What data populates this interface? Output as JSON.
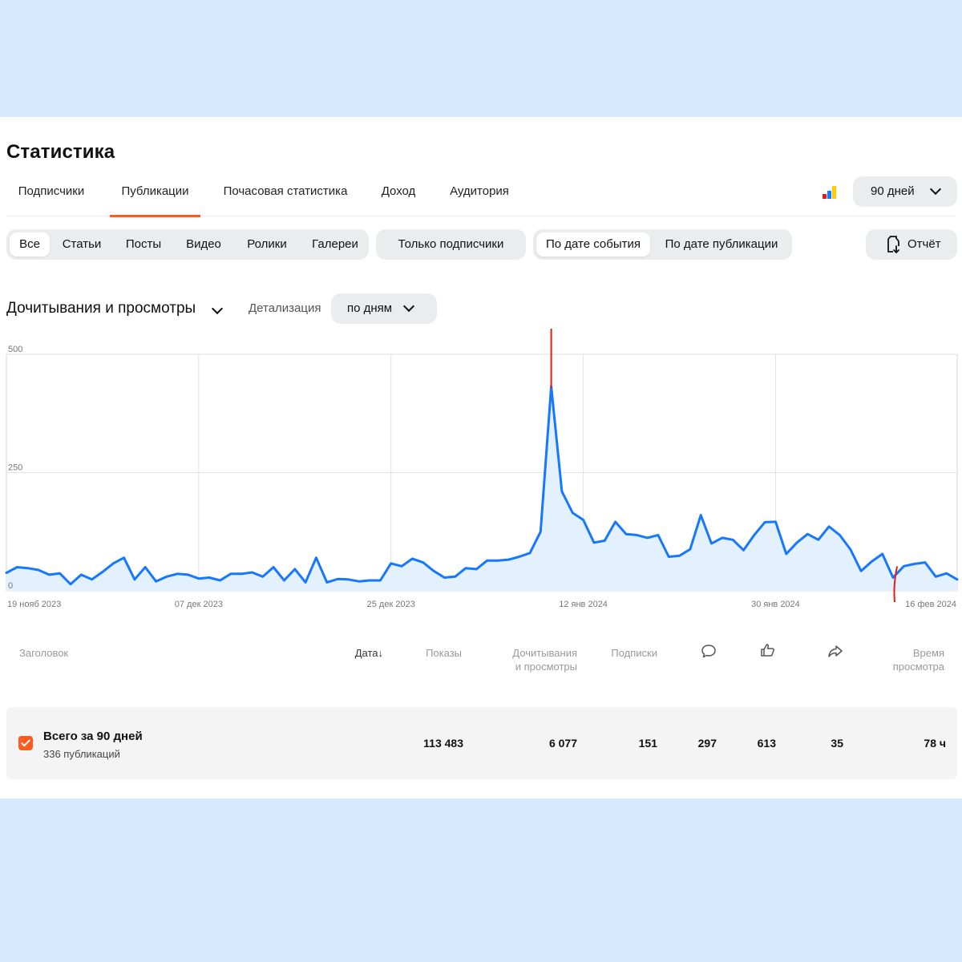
{
  "header": {
    "title": "Статистика"
  },
  "tabs": [
    {
      "label": "Подписчики"
    },
    {
      "label": "Публикации",
      "active": true
    },
    {
      "label": "Почасовая статистика"
    },
    {
      "label": "Доход"
    },
    {
      "label": "Аудитория"
    }
  ],
  "period": {
    "label": "90 дней"
  },
  "filters": {
    "types": [
      "Все",
      "Статьи",
      "Посты",
      "Видео",
      "Ролики",
      "Галереи"
    ],
    "selected_type": "Все",
    "subscribers_only": "Только подписчики",
    "date_modes": [
      "По дате события",
      "По дате публикации"
    ],
    "selected_date_mode": "По дате события"
  },
  "report_button": {
    "label": "Отчёт",
    "icon": "report-export-icon"
  },
  "metric": {
    "label": "Дочитывания и просмотры"
  },
  "detail": {
    "label": "Детализация",
    "value": "по дням"
  },
  "colors": {
    "accent": "#ff5a1f",
    "line": "#1677ff",
    "area": "#e3f0fd",
    "annotation": "#e31b1b"
  },
  "chart_data": {
    "type": "area",
    "ylim": [
      0,
      500
    ],
    "yticks": [
      "0",
      "250",
      "500"
    ],
    "xticks": [
      "19 нояб 2023",
      "07 дек 2023",
      "25 дек 2023",
      "12 янв 2024",
      "30 янв 2024",
      "16 фев 2024"
    ],
    "x_start": "2023-11-19",
    "x_end": "2024-02-16",
    "grid": true,
    "series": [
      {
        "values": [
          38,
          50,
          48,
          44,
          34,
          37,
          14,
          34,
          24,
          40,
          58,
          70,
          24,
          50,
          20,
          30,
          36,
          34,
          26,
          28,
          22,
          36,
          36,
          39,
          30,
          50,
          22,
          46,
          18,
          70,
          18,
          25,
          24,
          20,
          22,
          22,
          58,
          52,
          68,
          60,
          42,
          28,
          30,
          48,
          46,
          64,
          64,
          66,
          72,
          80,
          125,
          432,
          210,
          165,
          150,
          102,
          106,
          146,
          120,
          118,
          112,
          118,
          72,
          74,
          88,
          160,
          100,
          112,
          108,
          86,
          118,
          145,
          146,
          78,
          102,
          120,
          108,
          136,
          118,
          88,
          42,
          62,
          78,
          28,
          52,
          57,
          60,
          30,
          37,
          24
        ]
      }
    ],
    "annotations": [
      "peak-marker-line",
      "dip-marker-line"
    ]
  },
  "table": {
    "headers": {
      "title": "Заголовок",
      "date": "Дата",
      "impressions": "Показы",
      "reads_1": "Дочитывания",
      "reads_2": "и просмотры",
      "subscriptions": "Подписки",
      "comments_icon": "comment-icon",
      "likes_icon": "thumbs-up-icon",
      "shares_icon": "share-icon",
      "time_1": "Время",
      "time_2": "просмотра"
    },
    "total": {
      "title": "Всего за 90 дней",
      "subtitle": "336 публикаций",
      "impressions": "113 483",
      "reads": "6 077",
      "subscriptions": "151",
      "comments": "297",
      "likes": "613",
      "shares": "35",
      "watch_time": "78 ч"
    }
  }
}
